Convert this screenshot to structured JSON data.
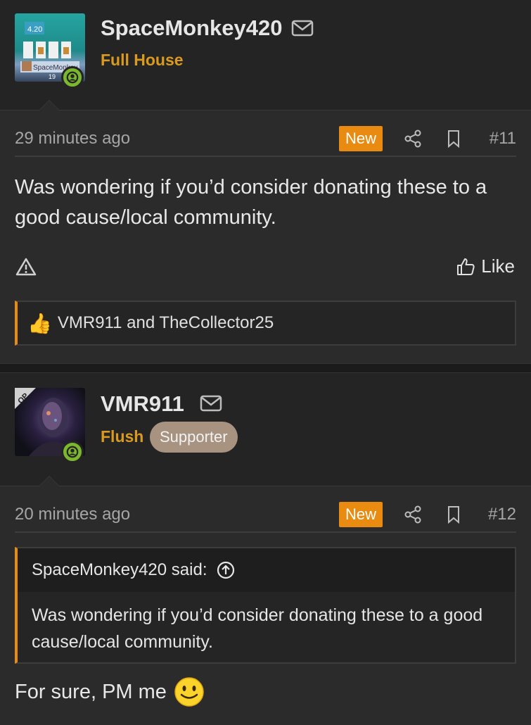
{
  "posts": [
    {
      "username": "SpaceMonkey420",
      "rank": "Full House",
      "avatar_text": {
        "top": "4.20",
        "name": "SpaceMonkey",
        "num": "19"
      },
      "timestamp": "29 minutes ago",
      "new_label": "New",
      "post_number": "#11",
      "body": "Was wondering if you’d consider donating these to a good cause/local community.",
      "like_label": "Like",
      "reactions": {
        "emoji": "👍",
        "text": "VMR911 and TheCollector25"
      }
    },
    {
      "username": "VMR911",
      "rank": "Flush",
      "badge": "Supporter",
      "op_label": "OP",
      "timestamp": "20 minutes ago",
      "new_label": "New",
      "post_number": "#12",
      "quote": {
        "author": "SpaceMonkey420 said:",
        "text": "Was wondering if you’d consider donating these to a good cause/local community."
      },
      "body": "For sure, PM me"
    }
  ],
  "colors": {
    "accent": "#e88b10",
    "rank": "#d99a1f",
    "online": "#7bb82f",
    "badge": "#a89380",
    "background": "#2b2b2b"
  },
  "icons": [
    "mail-icon",
    "share-icon",
    "bookmark-icon",
    "report-icon",
    "thumbs-up-icon",
    "quote-arrow-up-icon",
    "online-user-icon",
    "smiley-icon"
  ]
}
